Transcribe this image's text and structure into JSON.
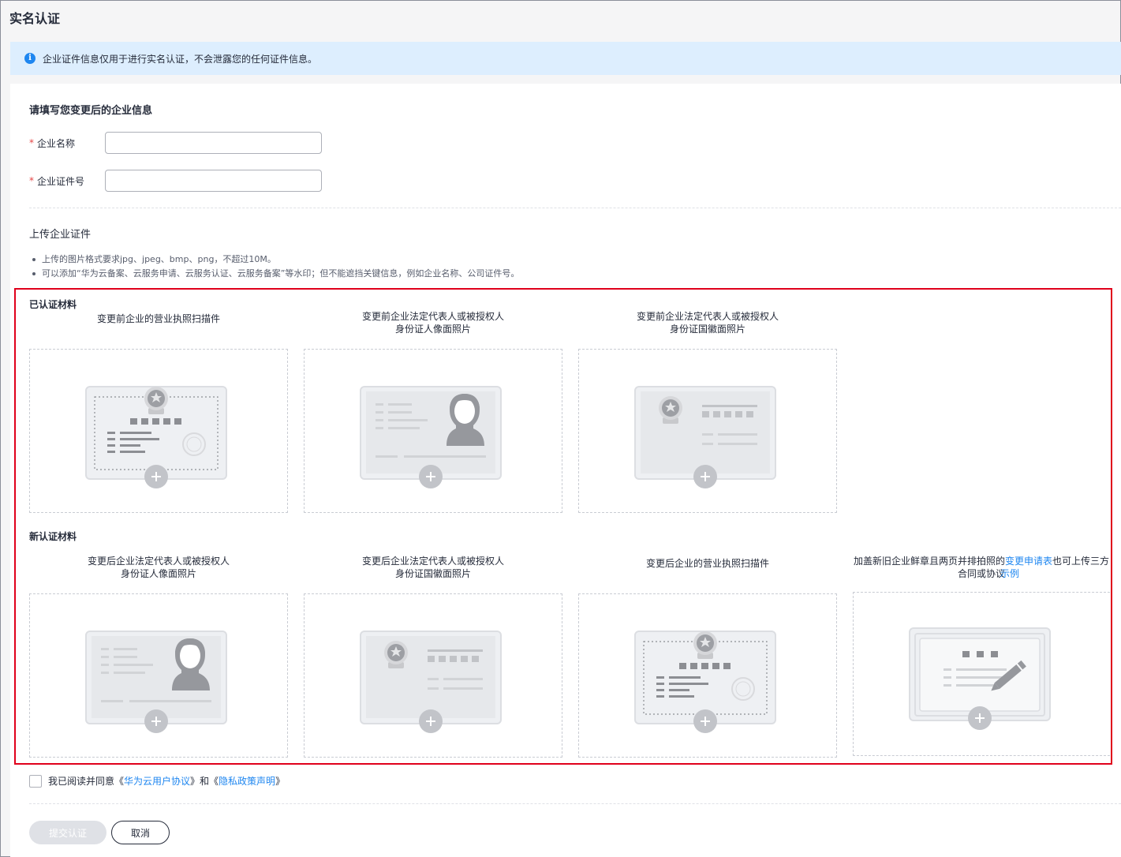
{
  "page": {
    "title": "实名认证"
  },
  "notice": {
    "text": "企业证件信息仅用于进行实名认证，不会泄露您的任何证件信息。"
  },
  "form": {
    "section_title": "请填写您变更后的企业信息",
    "required_mark": "*",
    "fields": [
      {
        "label": "企业名称",
        "value": "",
        "placeholder": ""
      },
      {
        "label": "企业证件号",
        "value": "",
        "placeholder": ""
      }
    ]
  },
  "upload": {
    "title": "上传企业证件",
    "rules": [
      "上传的图片格式要求jpg、jpeg、bmp、png，不超过10M。",
      "可以添加“华为云备案、云服务申请、云服务认证、云服务备案”等水印；但不能遮挡关键信息，例如企业名称、公司证件号。"
    ],
    "certified": {
      "label": "已认证材料",
      "slots": [
        {
          "line1": "变更前企业的营业执照扫描件",
          "line2": "",
          "icon": "business-license-icon"
        },
        {
          "line1": "变更前企业法定代表人或被授权人",
          "line2": "身份证人像面照片",
          "icon": "id-card-portrait-icon"
        },
        {
          "line1": "变更前企业法定代表人或被授权人",
          "line2": "身份证国徽面照片",
          "icon": "id-card-emblem-icon"
        }
      ]
    },
    "new": {
      "label": "新认证材料",
      "slots": [
        {
          "line1": "变更后企业法定代表人或被授权人",
          "line2": "身份证人像面照片",
          "icon": "id-card-portrait-icon"
        },
        {
          "line1": "变更后企业法定代表人或被授权人",
          "line2": "身份证国徽面照片",
          "icon": "id-card-emblem-icon"
        },
        {
          "line1": "变更后企业的营业执照扫描件",
          "line2": "",
          "icon": "business-license-icon"
        }
      ],
      "special_slot": {
        "prefix": "加盖新旧企业鲜章且两页并排拍照的",
        "link": "变更申请表",
        "suffix": "也可上传三方合同或协议",
        "example_link": "示例",
        "icon": "signed-document-icon"
      }
    }
  },
  "agreement": {
    "prefix": "我已阅读并同意《",
    "link1": "华为云用户协议",
    "middle": "》和《",
    "link2": "隐私政策声明",
    "suffix": "》"
  },
  "buttons": {
    "submit": "提交认证",
    "cancel": "取消"
  },
  "colors": {
    "accent": "#1e86f0",
    "required": "#e54545",
    "highlight": "#e0001b",
    "notice_bg": "#ddeefe"
  }
}
